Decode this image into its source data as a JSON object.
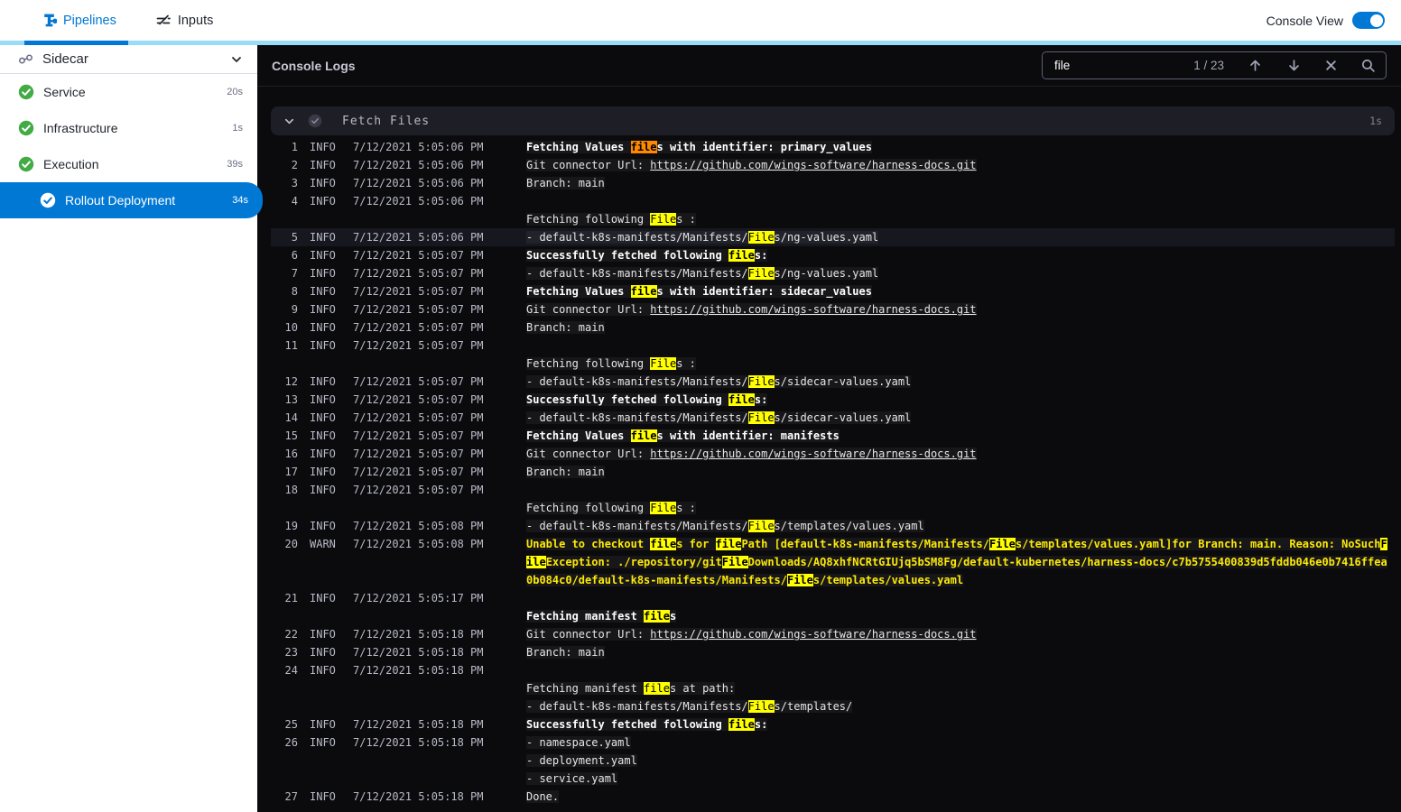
{
  "topbar": {
    "tabs": [
      {
        "label": "Pipelines",
        "icon": "pipeline-icon",
        "active": true
      },
      {
        "label": "Inputs",
        "icon": "inputs-icon",
        "active": false
      }
    ],
    "console_view": {
      "label": "Console View",
      "on": true
    }
  },
  "sidebar": {
    "group": {
      "label": "Sidecar",
      "icon": "link-icon"
    },
    "steps": [
      {
        "label": "Service",
        "duration": "20s",
        "status": "success",
        "selected": false,
        "indent": 0
      },
      {
        "label": "Infrastructure",
        "duration": "1s",
        "status": "success",
        "selected": false,
        "indent": 0
      },
      {
        "label": "Execution",
        "duration": "39s",
        "status": "success",
        "selected": false,
        "indent": 0
      },
      {
        "label": "Rollout Deployment",
        "duration": "34s",
        "status": "success",
        "selected": true,
        "indent": 1
      }
    ]
  },
  "console": {
    "title": "Console Logs",
    "search": {
      "value": "file",
      "count": "1 / 23",
      "icons": [
        "arrow-up-icon",
        "arrow-down-icon",
        "close-icon",
        "search-icon"
      ]
    },
    "section": {
      "title": "Fetch Files",
      "duration": "1s",
      "icons": [
        "chevron-down-icon",
        "check-circle-icon"
      ]
    }
  },
  "colors": {
    "accent_blue": "#0278d5",
    "accent_cyan": "#9adcf7",
    "success_green": "#42ab45",
    "console_bg": "#0b0b0e",
    "match_highlight": "#ffff00",
    "match_highlight_active": "#ff8800",
    "warn_text": "#fde905"
  },
  "log": {
    "entries": [
      {
        "n": "1",
        "lvl": "INFO",
        "time": "7/12/2021 5:05:06 PM",
        "rows": [
          [
            {
              "t": "Fetching Values ",
              "s": "b"
            },
            {
              "t": "file",
              "s": "a"
            },
            {
              "t": "s with identifier: primary_values",
              "s": "b"
            }
          ]
        ]
      },
      {
        "n": "2",
        "lvl": "INFO",
        "time": "7/12/2021 5:05:06 PM",
        "rows": [
          [
            {
              "t": "Git connector Url: ",
              "s": "p"
            },
            {
              "t": "https://github.com/wings-software/harness-docs.git",
              "s": "l"
            }
          ]
        ]
      },
      {
        "n": "3",
        "lvl": "INFO",
        "time": "7/12/2021 5:05:06 PM",
        "rows": [
          [
            {
              "t": "Branch: main",
              "s": "p"
            }
          ]
        ]
      },
      {
        "n": "4",
        "lvl": "INFO",
        "time": "7/12/2021 5:05:06 PM",
        "rows": [
          [],
          [
            {
              "t": "Fetching following ",
              "s": "p"
            },
            {
              "t": "File",
              "s": "h"
            },
            {
              "t": "s :",
              "s": "p"
            }
          ]
        ]
      },
      {
        "n": "5",
        "lvl": "INFO",
        "time": "7/12/2021 5:05:06 PM",
        "hl": true,
        "rows": [
          [
            {
              "t": "- default-k8s-manifests/Manifests/",
              "s": "p"
            },
            {
              "t": "File",
              "s": "h"
            },
            {
              "t": "s/ng-values.yaml",
              "s": "p"
            }
          ]
        ]
      },
      {
        "n": "6",
        "lvl": "INFO",
        "time": "7/12/2021 5:05:07 PM",
        "rows": [
          [
            {
              "t": "Successfully fetched following ",
              "s": "b"
            },
            {
              "t": "file",
              "s": "h"
            },
            {
              "t": "s:",
              "s": "b"
            }
          ]
        ]
      },
      {
        "n": "7",
        "lvl": "INFO",
        "time": "7/12/2021 5:05:07 PM",
        "rows": [
          [
            {
              "t": "- default-k8s-manifests/Manifests/",
              "s": "p"
            },
            {
              "t": "File",
              "s": "h"
            },
            {
              "t": "s/ng-values.yaml",
              "s": "p"
            }
          ]
        ]
      },
      {
        "n": "8",
        "lvl": "INFO",
        "time": "7/12/2021 5:05:07 PM",
        "rows": [
          [
            {
              "t": "Fetching Values ",
              "s": "b"
            },
            {
              "t": "file",
              "s": "h"
            },
            {
              "t": "s with identifier: sidecar_values",
              "s": "b"
            }
          ]
        ]
      },
      {
        "n": "9",
        "lvl": "INFO",
        "time": "7/12/2021 5:05:07 PM",
        "rows": [
          [
            {
              "t": "Git connector Url: ",
              "s": "p"
            },
            {
              "t": "https://github.com/wings-software/harness-docs.git",
              "s": "l"
            }
          ]
        ]
      },
      {
        "n": "10",
        "lvl": "INFO",
        "time": "7/12/2021 5:05:07 PM",
        "rows": [
          [
            {
              "t": "Branch: main",
              "s": "p"
            }
          ]
        ]
      },
      {
        "n": "11",
        "lvl": "INFO",
        "time": "7/12/2021 5:05:07 PM",
        "rows": [
          [],
          [
            {
              "t": "Fetching following ",
              "s": "p"
            },
            {
              "t": "File",
              "s": "h"
            },
            {
              "t": "s :",
              "s": "p"
            }
          ]
        ]
      },
      {
        "n": "12",
        "lvl": "INFO",
        "time": "7/12/2021 5:05:07 PM",
        "rows": [
          [
            {
              "t": "- default-k8s-manifests/Manifests/",
              "s": "p"
            },
            {
              "t": "File",
              "s": "h"
            },
            {
              "t": "s/sidecar-values.yaml",
              "s": "p"
            }
          ]
        ]
      },
      {
        "n": "13",
        "lvl": "INFO",
        "time": "7/12/2021 5:05:07 PM",
        "rows": [
          [
            {
              "t": "Successfully fetched following ",
              "s": "b"
            },
            {
              "t": "file",
              "s": "h"
            },
            {
              "t": "s:",
              "s": "b"
            }
          ]
        ]
      },
      {
        "n": "14",
        "lvl": "INFO",
        "time": "7/12/2021 5:05:07 PM",
        "rows": [
          [
            {
              "t": "- default-k8s-manifests/Manifests/",
              "s": "p"
            },
            {
              "t": "File",
              "s": "h"
            },
            {
              "t": "s/sidecar-values.yaml",
              "s": "p"
            }
          ]
        ]
      },
      {
        "n": "15",
        "lvl": "INFO",
        "time": "7/12/2021 5:05:07 PM",
        "rows": [
          [
            {
              "t": "Fetching Values ",
              "s": "b"
            },
            {
              "t": "file",
              "s": "h"
            },
            {
              "t": "s with identifier: manifests",
              "s": "b"
            }
          ]
        ]
      },
      {
        "n": "16",
        "lvl": "INFO",
        "time": "7/12/2021 5:05:07 PM",
        "rows": [
          [
            {
              "t": "Git connector Url: ",
              "s": "p"
            },
            {
              "t": "https://github.com/wings-software/harness-docs.git",
              "s": "l"
            }
          ]
        ]
      },
      {
        "n": "17",
        "lvl": "INFO",
        "time": "7/12/2021 5:05:07 PM",
        "rows": [
          [
            {
              "t": "Branch: main",
              "s": "p"
            }
          ]
        ]
      },
      {
        "n": "18",
        "lvl": "INFO",
        "time": "7/12/2021 5:05:07 PM",
        "rows": [
          [],
          [
            {
              "t": "Fetching following ",
              "s": "p"
            },
            {
              "t": "File",
              "s": "h"
            },
            {
              "t": "s :",
              "s": "p"
            }
          ]
        ]
      },
      {
        "n": "19",
        "lvl": "INFO",
        "time": "7/12/2021 5:05:08 PM",
        "rows": [
          [
            {
              "t": "- default-k8s-manifests/Manifests/",
              "s": "p"
            },
            {
              "t": "File",
              "s": "h"
            },
            {
              "t": "s/templates/values.yaml",
              "s": "p"
            }
          ]
        ]
      },
      {
        "n": "20",
        "lvl": "WARN",
        "time": "7/12/2021 5:05:08 PM",
        "rows": [
          [
            {
              "t": "Unable to checkout ",
              "s": "w"
            },
            {
              "t": "file",
              "s": "h"
            },
            {
              "t": "s for ",
              "s": "w"
            },
            {
              "t": "file",
              "s": "h"
            },
            {
              "t": "Path [default-k8s-manifests/Manifests/",
              "s": "w"
            },
            {
              "t": "File",
              "s": "h"
            },
            {
              "t": "s/templates/values.yaml]for Branch: main. Reason: NoSuch",
              "s": "w"
            },
            {
              "t": "F",
              "s": "h"
            }
          ],
          [
            {
              "t": "ile",
              "s": "h"
            },
            {
              "t": "Exception: ./repository/git",
              "s": "w"
            },
            {
              "t": "File",
              "s": "h"
            },
            {
              "t": "Downloads/AQ8xhfNCRtGIUjq5bSM8Fg/default-kubernetes/harness-docs/c7b5755400839d5fddb046e0b7416ffea",
              "s": "w"
            }
          ],
          [
            {
              "t": "0b084c0/default-k8s-manifests/Manifests/",
              "s": "w"
            },
            {
              "t": "File",
              "s": "h"
            },
            {
              "t": "s/templates/values.yaml",
              "s": "w"
            }
          ]
        ]
      },
      {
        "n": "21",
        "lvl": "INFO",
        "time": "7/12/2021 5:05:17 PM",
        "rows": [
          [],
          [
            {
              "t": "Fetching manifest ",
              "s": "b"
            },
            {
              "t": "file",
              "s": "h"
            },
            {
              "t": "s",
              "s": "b"
            }
          ]
        ]
      },
      {
        "n": "22",
        "lvl": "INFO",
        "time": "7/12/2021 5:05:18 PM",
        "rows": [
          [
            {
              "t": "Git connector Url: ",
              "s": "p"
            },
            {
              "t": "https://github.com/wings-software/harness-docs.git",
              "s": "l"
            }
          ]
        ]
      },
      {
        "n": "23",
        "lvl": "INFO",
        "time": "7/12/2021 5:05:18 PM",
        "rows": [
          [
            {
              "t": "Branch: main",
              "s": "p"
            }
          ]
        ]
      },
      {
        "n": "24",
        "lvl": "INFO",
        "time": "7/12/2021 5:05:18 PM",
        "rows": [
          [],
          [
            {
              "t": "Fetching manifest ",
              "s": "p"
            },
            {
              "t": "file",
              "s": "h"
            },
            {
              "t": "s at path:",
              "s": "p"
            }
          ],
          [
            {
              "t": "- default-k8s-manifests/Manifests/",
              "s": "p"
            },
            {
              "t": "File",
              "s": "h"
            },
            {
              "t": "s/templates/",
              "s": "p"
            }
          ]
        ]
      },
      {
        "n": "25",
        "lvl": "INFO",
        "time": "7/12/2021 5:05:18 PM",
        "rows": [
          [
            {
              "t": "Successfully fetched following ",
              "s": "b"
            },
            {
              "t": "file",
              "s": "h"
            },
            {
              "t": "s:",
              "s": "b"
            }
          ]
        ]
      },
      {
        "n": "26",
        "lvl": "INFO",
        "time": "7/12/2021 5:05:18 PM",
        "rows": [
          [
            {
              "t": "- namespace.yaml",
              "s": "p"
            }
          ],
          [
            {
              "t": "- deployment.yaml",
              "s": "p"
            }
          ],
          [
            {
              "t": "- service.yaml",
              "s": "p"
            }
          ]
        ]
      },
      {
        "n": "27",
        "lvl": "INFO",
        "time": "7/12/2021 5:05:18 PM",
        "rows": [
          [
            {
              "t": "Done.",
              "s": "p"
            }
          ]
        ]
      }
    ]
  }
}
